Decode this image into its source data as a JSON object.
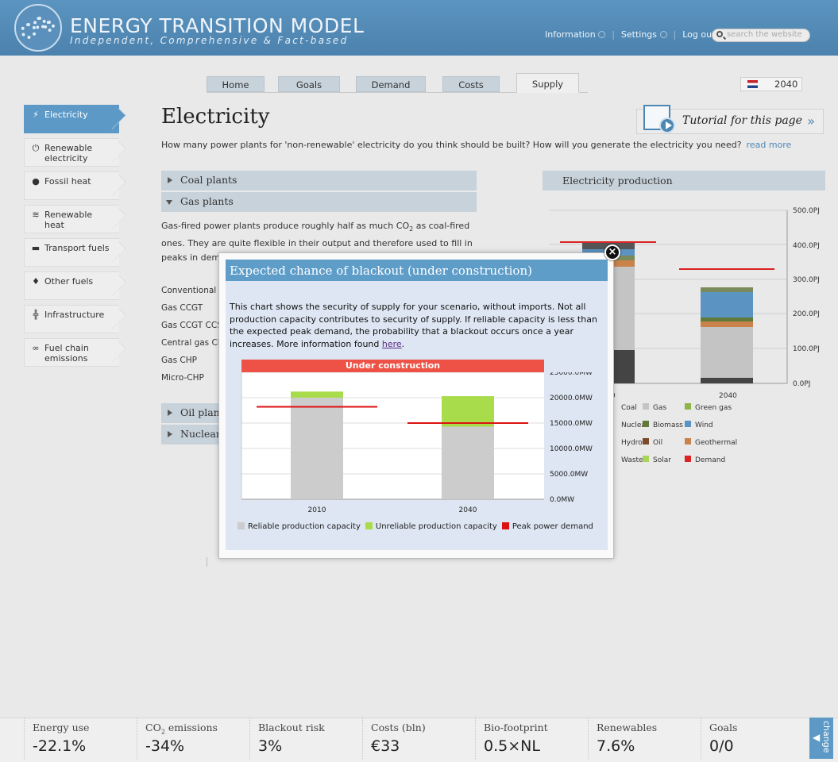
{
  "header": {
    "title": "ENERGY TRANSITION MODEL",
    "subtitle": "Independent, Comprehensive & Fact-based",
    "nav": {
      "information": "Information",
      "settings": "Settings",
      "logout": "Log out"
    },
    "search_placeholder": "search the website"
  },
  "tabs": [
    {
      "label": "Home"
    },
    {
      "label": "Goals"
    },
    {
      "label": "Demand"
    },
    {
      "label": "Costs"
    },
    {
      "label": "Supply",
      "active": true
    }
  ],
  "year": "2040",
  "sidebar": [
    {
      "label": "Electricity",
      "icon": "bolt-icon",
      "active": true
    },
    {
      "label": "Renewable electricity",
      "icon": "power-icon"
    },
    {
      "label": "Fossil heat",
      "icon": "coal-icon"
    },
    {
      "label": "Renewable heat",
      "icon": "heat-icon"
    },
    {
      "label": "Transport fuels",
      "icon": "car-icon"
    },
    {
      "label": "Other fuels",
      "icon": "drop-icon"
    },
    {
      "label": "Infrastructure",
      "icon": "pylon-icon"
    },
    {
      "label": "Fuel chain emissions",
      "icon": "chain-icon"
    }
  ],
  "main": {
    "title": "Electricity",
    "intro": "How many power plants for 'non-renewable' electricity do you think should be built? How will you generate the electricity you need?",
    "read_more": "read more",
    "tutorial": "Tutorial for this page",
    "accordions": {
      "coal": "Coal plants",
      "gas": "Gas plants",
      "oil": "Oil plants",
      "nuclear": "Nuclear plants"
    },
    "gas_text_1": "Gas-fired power plants produce roughly half as much CO",
    "gas_text_sub": "2",
    "gas_text_2": " as coal-fired ones. They are quite flexible in their output and therefore used to fill in peaks in demand.",
    "sliders": [
      "Conventional",
      "Gas CCGT",
      "Gas CCGT CCS",
      "Central gas CHP",
      "Gas CHP",
      "Micro-CHP"
    ]
  },
  "bg_chart": {
    "title": "Electricity production",
    "y_ticks": [
      "500.0PJ",
      "400.0PJ",
      "300.0PJ",
      "200.0PJ",
      "100.0PJ",
      "0.0PJ"
    ],
    "x_tick_2040": "2040",
    "x_tick_2010_partial": "0",
    "legend": [
      {
        "label": "Coal",
        "color": "#4a4a4a"
      },
      {
        "label": "Gas",
        "color": "#c4c4c4"
      },
      {
        "label": "Green gas",
        "color": "#8db54a"
      },
      {
        "label": "Nuclear",
        "color": "#7a8a5a"
      },
      {
        "label": "Biomass",
        "color": "#5f7a3a"
      },
      {
        "label": "Wind",
        "color": "#5b93c2"
      },
      {
        "label": "Hydro",
        "color": "#3a6aa0"
      },
      {
        "label": "Oil",
        "color": "#7a4a2a"
      },
      {
        "label": "Geothermal",
        "color": "#c8824a"
      },
      {
        "label": "Waste",
        "color": "#8a7a5a"
      },
      {
        "label": "Solar",
        "color": "#a8d45a"
      },
      {
        "label": "Demand",
        "color": "#dd2222"
      }
    ]
  },
  "modal": {
    "title": "Expected chance of blackout (under construction)",
    "text": "This chart shows the security of supply for your scenario, without imports. Not all production capacity contributes to security of supply. If reliable capacity is less than the expected peak demand, the probability that a blackout occurs once a year increases. More information found ",
    "link": "here",
    "banner": "Under construction",
    "close": "×"
  },
  "chart_data": {
    "type": "bar",
    "categories": [
      "2010",
      "2040"
    ],
    "series": [
      {
        "name": "Reliable production capacity",
        "color": "#cccccc",
        "values": [
          20000,
          14300
        ]
      },
      {
        "name": "Unreliable production capacity",
        "color": "#a9dc4b",
        "values": [
          1200,
          6000
        ]
      },
      {
        "name": "Peak power demand",
        "color": "#dd1111",
        "values": [
          18200,
          15000
        ]
      }
    ],
    "y_ticks": [
      "25000.0MW",
      "20000.0MW",
      "15000.0MW",
      "10000.0MW",
      "5000.0MW",
      "0.0MW"
    ],
    "ylim": [
      0,
      25000
    ]
  },
  "footer": [
    {
      "label": "Energy use",
      "value": "-22.1%"
    },
    {
      "label": "CO2 emissions",
      "value": "-34%"
    },
    {
      "label": "Blackout risk",
      "value": "3%"
    },
    {
      "label": "Costs (bln)",
      "value": "€33"
    },
    {
      "label": "Bio-footprint",
      "value": "0.5×NL"
    },
    {
      "label": "Renewables",
      "value": "7.6%"
    },
    {
      "label": "Goals",
      "value": "0/0"
    }
  ],
  "change_label": "change"
}
